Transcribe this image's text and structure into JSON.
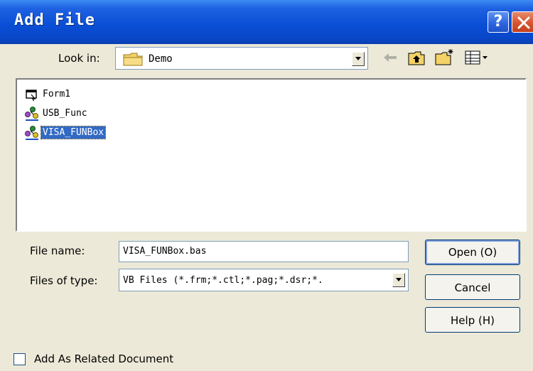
{
  "window": {
    "title": "Add File"
  },
  "look_in": {
    "label": "Look in:",
    "value": "Demo"
  },
  "files": [
    {
      "name": "Form1",
      "icon": "form-icon",
      "selected": false
    },
    {
      "name": "USB_Func",
      "icon": "module-icon",
      "selected": false
    },
    {
      "name": "VISA_FUNBox",
      "icon": "module-icon",
      "selected": true
    }
  ],
  "file_name": {
    "label": "File name:",
    "value": "VISA_FUNBox.bas"
  },
  "file_type": {
    "label": "Files of type:",
    "value": "VB Files (*.frm;*.ctl;*.pag;*.dsr;*."
  },
  "buttons": {
    "open": "Open (O)",
    "cancel": "Cancel",
    "help": "Help (H)"
  },
  "checkbox": {
    "label": "Add As Related Document",
    "checked": false
  },
  "colors": {
    "titlebar": "#0a4fd6",
    "selection": "#316ac5",
    "dialog_bg": "#ece9d8"
  }
}
